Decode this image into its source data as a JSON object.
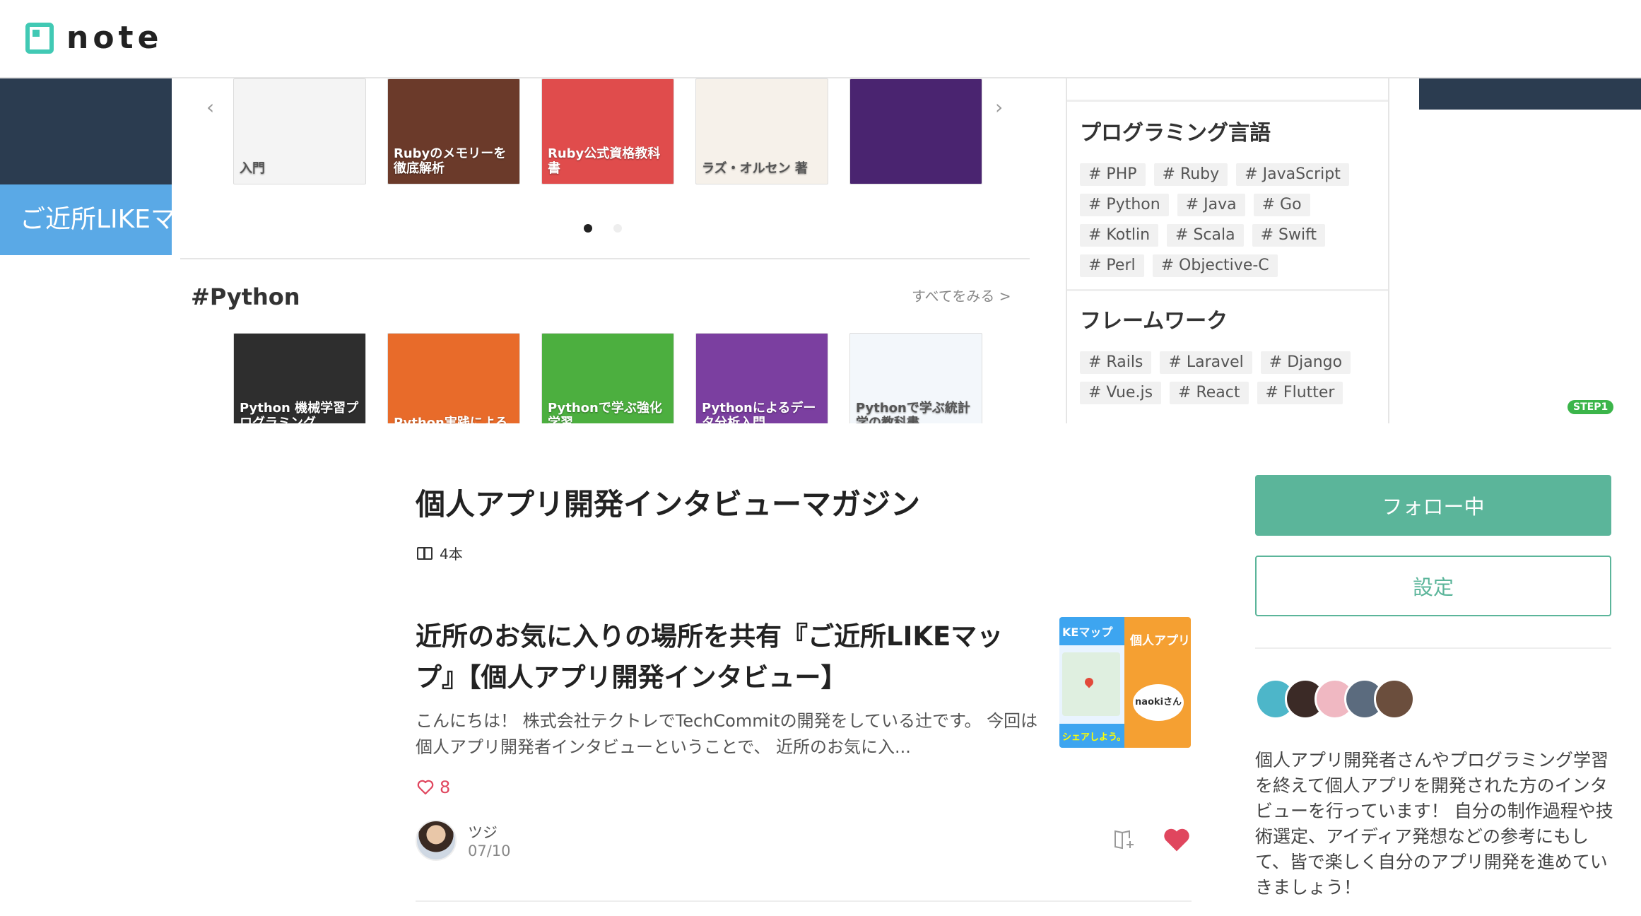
{
  "header": {
    "logo_text": "note"
  },
  "hero": {
    "left_banner_text": "ご近所LIKEマ",
    "prev_arrow": "‹",
    "next_arrow": "›",
    "top_books": [
      {
        "label": "入門",
        "color": "#f4f4f4"
      },
      {
        "label": "Rubyのメモリーを徹底解析",
        "color": "#6b3a2a"
      },
      {
        "label": "Ruby公式資格教科書",
        "color": "#e04c4c"
      },
      {
        "label": "ラズ・オルセン 著",
        "color": "#f6f1ea"
      },
      {
        "label": "",
        "color": "#4a2470"
      }
    ],
    "bottom_books": [
      {
        "label": "Python 機械学習プログラミング",
        "color": "#2e2e2e"
      },
      {
        "label": "Python実践による",
        "color": "#e86b2a"
      },
      {
        "label": "Pythonで学ぶ強化学習",
        "color": "#4caf3f"
      },
      {
        "label": "Pythonによるデータ分析入門",
        "color": "#7b3fa0"
      },
      {
        "label": "Pythonで学ぶ統計学の教科書",
        "color": "#f3f7fb"
      }
    ],
    "section_tag": "#Python",
    "see_all": "すべてをみる >",
    "step_badge": "STEP1",
    "panel_languages": {
      "title": "プログラミング言語",
      "tags": [
        "# PHP",
        "# Ruby",
        "# JavaScript",
        "# Python",
        "# Java",
        "# Go",
        "# Kotlin",
        "# Scala",
        "# Swift",
        "# Perl",
        "# Objective-C"
      ]
    },
    "panel_frameworks": {
      "title": "フレームワーク",
      "tags": [
        "# Rails",
        "# Laravel",
        "# Django",
        "# Vue.js",
        "# React",
        "# Flutter"
      ]
    }
  },
  "magazine": {
    "title": "個人アプリ開発インタビューマガジン",
    "count": "4本"
  },
  "article": {
    "title": "近所のお気に入りの場所を共有『ご近所LIKEマップ』【個人アプリ開発インタビュー】",
    "excerpt": "こんにちは！ 株式会社テクトレでTechCommitの開発をしている辻です。 今回は個人アプリ開発者インタビューということで、 近所のお気に入...",
    "likes": "8",
    "author": "ツジ",
    "date": "07/10",
    "thumb": {
      "left_top": "KEマップ",
      "left_bottom": "シェアしよう。",
      "right_text": "個人アプリ開発イン",
      "bubble": "naokiさん"
    }
  },
  "sidebar": {
    "follow_label": "フォロー中",
    "settings_label": "設定",
    "avatar_colors": [
      "#4db6c9",
      "#3b2a26",
      "#f0b8c2",
      "#5b6b7e",
      "#6b4e3d"
    ],
    "description": "個人アプリ開発者さんやプログラミング学習を終えて個人アプリを開発された方のインタビューを行っています！ 自分の制作過程や技術選定、アイディア発想などの参考にもして、皆で楽しく自分のアプリ開発を進めていきましょう！"
  }
}
